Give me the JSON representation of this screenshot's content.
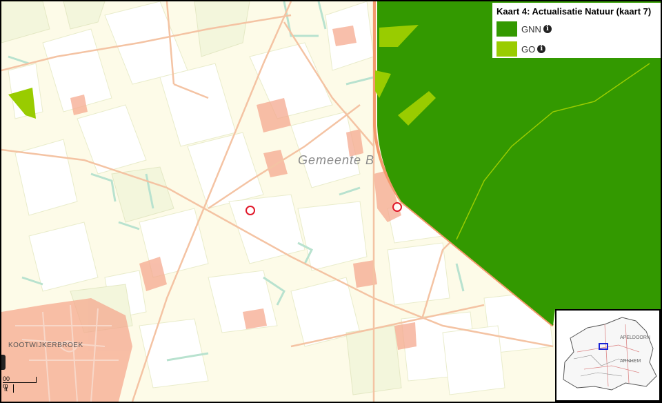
{
  "legend": {
    "title": "Kaart 4: Actualisatie Natuur (kaart 7)",
    "items": [
      {
        "label": "GNN",
        "color": "#339900",
        "icon": "info-icon"
      },
      {
        "label": "GO",
        "color": "#99cc00",
        "icon": "info-icon"
      }
    ]
  },
  "map": {
    "municipality_label": "Gemeente  B",
    "village_label": "KOOTWIJKERBROEK",
    "markers": [
      "location-marker-1",
      "location-marker-2"
    ],
    "colors": {
      "background": "#fdfbe8",
      "field": "#ffffff",
      "field_alt": "#f3f6dc",
      "road": "#f4c3a3",
      "road_main": "#f39a6c",
      "ditch": "#b8e2cf",
      "built": "#f5a98f",
      "gnn": "#339900",
      "go": "#99cc00",
      "marker": "#e0182a"
    }
  },
  "scalebar": {
    "metric_label": "00 m",
    "imperial_label": "ft"
  },
  "overview": {
    "labels": [
      "APELDOORN",
      "ARNHEM"
    ]
  }
}
